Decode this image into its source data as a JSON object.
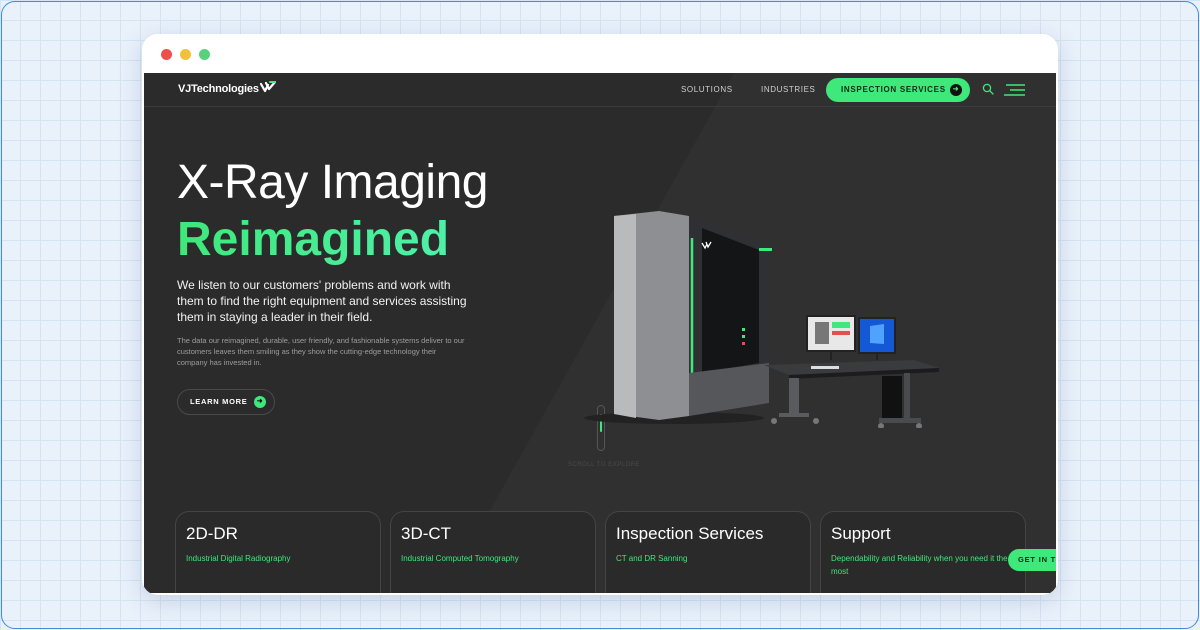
{
  "window": {
    "controls": [
      "close",
      "minimize",
      "maximize"
    ]
  },
  "nav": {
    "logo_text": "VJTechnologies",
    "logo_icon": "vj-check-logo",
    "links": [
      {
        "label": "SOLUTIONS"
      },
      {
        "label": "INDUSTRIES"
      }
    ],
    "cta_label": "INSPECTION SERVICES",
    "search_icon": "search-icon",
    "menu_icon": "hamburger-menu-icon"
  },
  "hero": {
    "title": "X-Ray Imaging",
    "title_accent": "Reimagined",
    "lead": "We listen to our customers' problems and work with them to find the right equipment and services assisting them in staying a leader in their field.",
    "body": "The data our reimagined, durable, user friendly, and fashionable systems deliver to our customers leaves them smiling as they show the cutting-edge technology their company has invested in.",
    "button_label": "LEARN MORE",
    "scroll_label": "SCROLL TO EXPLORE"
  },
  "cards": [
    {
      "title": "2D-DR",
      "subtitle": "Industrial Digital Radiography"
    },
    {
      "title": "3D-CT",
      "subtitle": "Industrial Computed Tomography"
    },
    {
      "title": "Inspection Services",
      "subtitle": "CT and DR Sanning"
    },
    {
      "title": "Support",
      "subtitle": "Dependability and Reliability when you need it the most"
    }
  ],
  "floating_button": {
    "label": "GET IN T"
  },
  "colors": {
    "accent": "#3ee87a",
    "site_background": "#2b2b2b",
    "page_background": "#e9f1fb"
  }
}
